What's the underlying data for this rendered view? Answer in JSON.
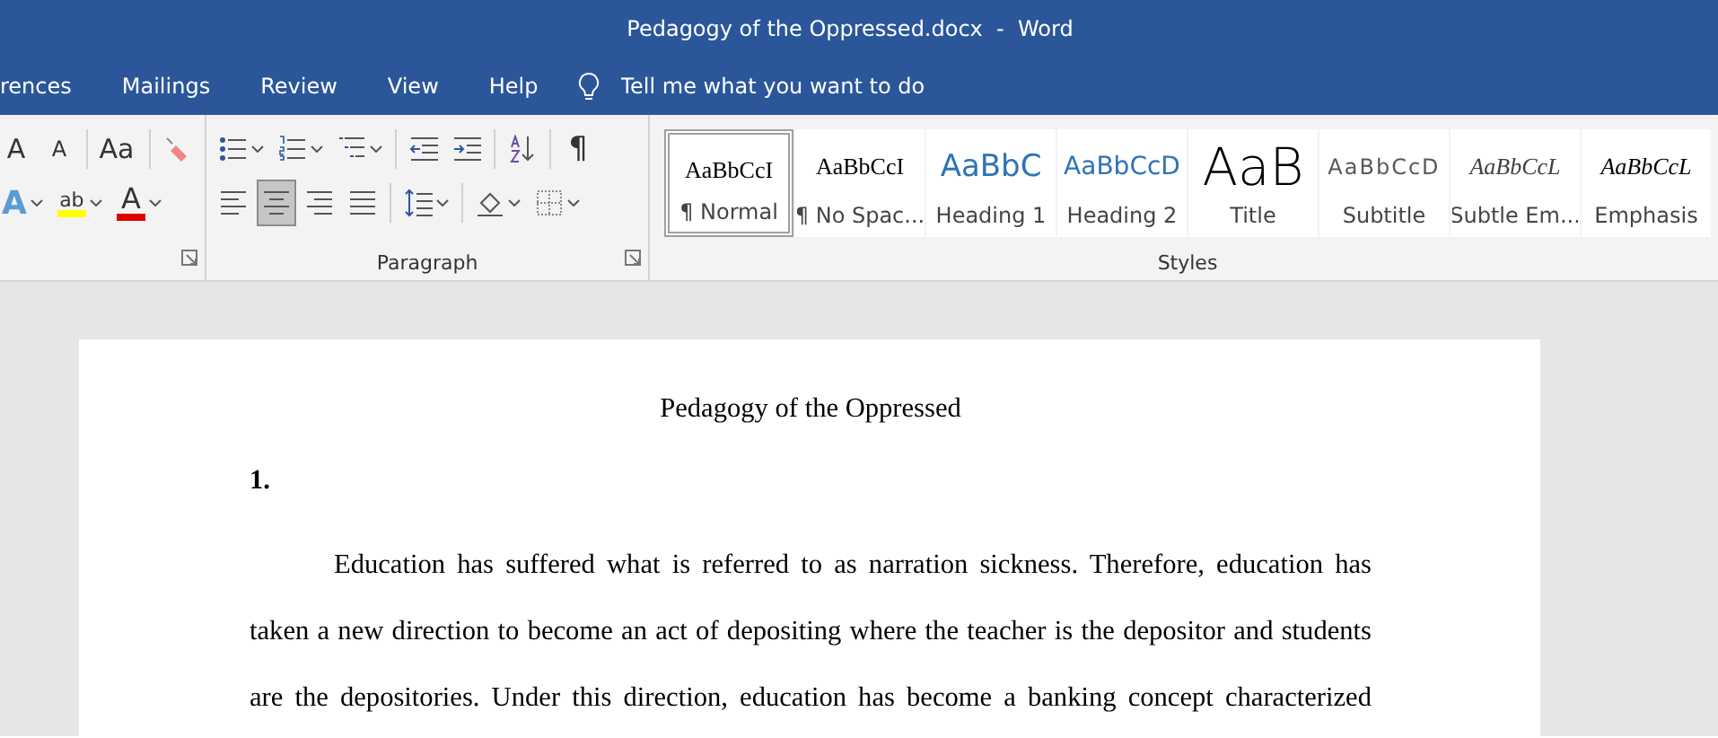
{
  "window": {
    "title": "Pedagogy of the Oppressed.docx  -  Word"
  },
  "tabs": [
    {
      "label": "rences",
      "selected": false
    },
    {
      "label": "Mailings",
      "selected": false
    },
    {
      "label": "Review",
      "selected": false
    },
    {
      "label": "View",
      "selected": false
    },
    {
      "label": "Help",
      "selected": false
    }
  ],
  "tell_me": {
    "placeholder": "Tell me what you want to do"
  },
  "font_group": {
    "row1": [
      {
        "kind": "grow",
        "label": "A"
      },
      {
        "kind": "shrink",
        "label": "A"
      },
      {
        "kind": "case",
        "label": "Aa"
      },
      {
        "kind": "clear"
      }
    ],
    "row2": [
      {
        "kind": "effects",
        "label": "A"
      },
      {
        "kind": "highlight",
        "label": "ab",
        "color": "#ffff00"
      },
      {
        "kind": "fontcolor",
        "label": "A",
        "color": "#e00000"
      }
    ]
  },
  "paragraph_group": {
    "label": "Paragraph",
    "row1": [
      {
        "kind": "bullets"
      },
      {
        "kind": "numbering"
      },
      {
        "kind": "multilevel"
      },
      {
        "kind": "outdent"
      },
      {
        "kind": "indent"
      },
      {
        "kind": "sort"
      },
      {
        "kind": "marks",
        "label": "¶"
      }
    ],
    "row2": [
      {
        "kind": "align-left",
        "selected": false
      },
      {
        "kind": "align-center",
        "selected": true
      },
      {
        "kind": "align-right",
        "selected": false
      },
      {
        "kind": "justify",
        "selected": false
      },
      {
        "kind": "spacing"
      },
      {
        "kind": "shading"
      },
      {
        "kind": "borders"
      }
    ]
  },
  "styles": {
    "label": "Styles",
    "items": [
      {
        "kind": "normal",
        "preview": "AaBbCcI",
        "name": "¶ Normal",
        "selected": true
      },
      {
        "kind": "nospacing",
        "preview": "AaBbCcI",
        "name": "¶ No Spac...",
        "selected": false
      },
      {
        "kind": "heading1",
        "preview": "AaBbC",
        "name": "Heading 1",
        "selected": false
      },
      {
        "kind": "heading2",
        "preview": "AaBbCcD",
        "name": "Heading 2",
        "selected": false
      },
      {
        "kind": "title",
        "preview": "AaB",
        "name": "Title",
        "selected": false
      },
      {
        "kind": "subtitle",
        "preview": "AaBbCcD",
        "name": "Subtitle",
        "selected": false
      },
      {
        "kind": "subtle",
        "preview": "AaBbCcL",
        "name": "Subtle Em...",
        "selected": false
      },
      {
        "kind": "emphasis",
        "preview": "AaBbCcL",
        "name": "Emphasis",
        "selected": false
      }
    ]
  },
  "document": {
    "title": "Pedagogy of the Oppressed",
    "heading": "1.",
    "paragraph": "Education has suffered what is referred to as narration sickness. Therefore, education has taken a new direction to become an act of depositing where the teacher is the depositor and students are the depositories. Under this direction, education has become a banking concept characterized"
  }
}
